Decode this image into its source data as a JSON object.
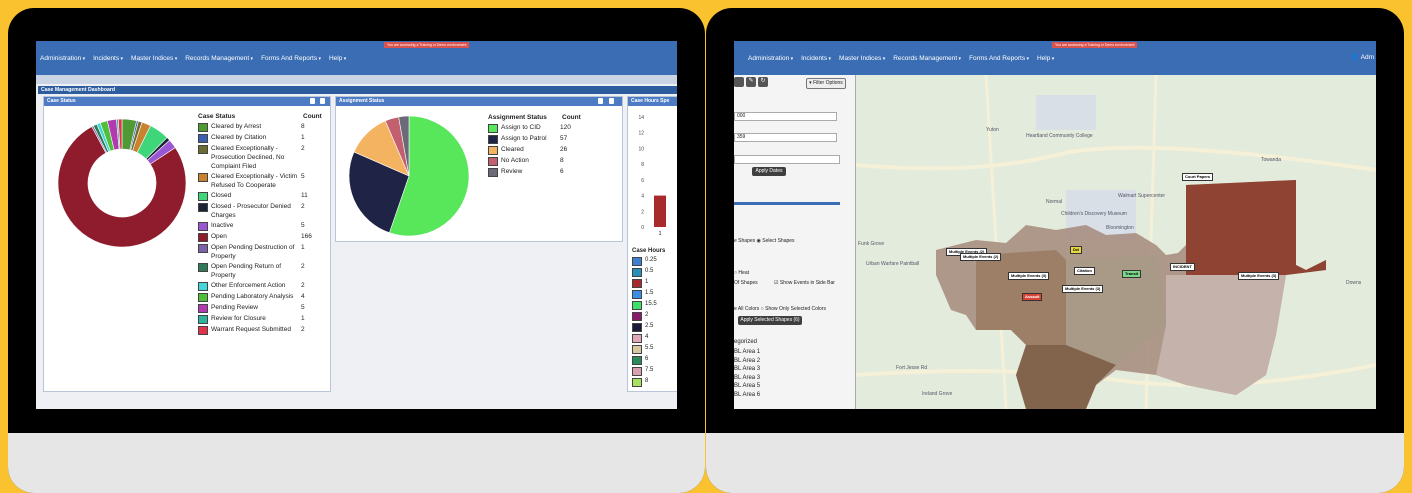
{
  "left_screen": {
    "nav": {
      "items": [
        "Administration",
        "Incidents",
        "Master Indices",
        "Records Management",
        "Forms And Reports",
        "Help"
      ],
      "notice": "You are accessing a Training or Demo environment"
    },
    "dashboard_title": "Case Management Dashboard",
    "case_status": {
      "title": "Case Status",
      "col_status": "Case Status",
      "col_count": "Count",
      "rows": [
        {
          "label": "Cleared by Arrest",
          "count": "8",
          "color": "#4f9a34"
        },
        {
          "label": "Cleared by Citation",
          "count": "1",
          "color": "#3b5fae"
        },
        {
          "label": "Cleared Exceptionally - Prosecution Declined, No Complaint Filed",
          "count": "2",
          "color": "#6b6b34"
        },
        {
          "label": "Cleared Exceptionally - Victim Refused To Cooperate",
          "count": "5",
          "color": "#c9822e"
        },
        {
          "label": "Closed",
          "count": "11",
          "color": "#3fd67a"
        },
        {
          "label": "Closed - Prosecutor Denied Charges",
          "count": "2",
          "color": "#1d2436"
        },
        {
          "label": "Inactive",
          "count": "5",
          "color": "#9b57d3"
        },
        {
          "label": "Open",
          "count": "166",
          "color": "#8f1c2c"
        },
        {
          "label": "Open Pending Destruction of Property",
          "count": "1",
          "color": "#7e62a8"
        },
        {
          "label": "Open Pending Return of Property",
          "count": "2",
          "color": "#2f7a58"
        },
        {
          "label": "Other Enforcement Action",
          "count": "2",
          "color": "#45d6d9"
        },
        {
          "label": "Pending Laboratory Analysis",
          "count": "4",
          "color": "#4fbf3a"
        },
        {
          "label": "Pending Review",
          "count": "5",
          "color": "#b13ab0"
        },
        {
          "label": "Review for Closure",
          "count": "1",
          "color": "#2ab59c"
        },
        {
          "label": "Warrant Request Submitted",
          "count": "2",
          "color": "#e0344a"
        }
      ]
    },
    "assignment_status": {
      "title": "Assignment Status",
      "col_status": "Assignment Status",
      "col_count": "Count",
      "rows": [
        {
          "label": "Assign to CID",
          "count": "120",
          "color": "#58e65a"
        },
        {
          "label": "Assign to Patrol",
          "count": "57",
          "color": "#1f2346"
        },
        {
          "label": "Cleared",
          "count": "26",
          "color": "#f3b360"
        },
        {
          "label": "No Action",
          "count": "8",
          "color": "#c36070"
        },
        {
          "label": "Review",
          "count": "6",
          "color": "#6a6a78"
        }
      ]
    },
    "case_hours": {
      "title": "Case Hours Spe",
      "y_ticks": [
        "14",
        "12",
        "10",
        "8",
        "6",
        "4",
        "2",
        "0"
      ],
      "x_tick": "1",
      "legend_title": "Case Hours",
      "legend": [
        {
          "label": "0.25",
          "color": "#3f7fd0"
        },
        {
          "label": "0.5",
          "color": "#2a8fb8"
        },
        {
          "label": "1",
          "color": "#a82a2a"
        },
        {
          "label": "1.5",
          "color": "#3b8ee6"
        },
        {
          "label": "15.5",
          "color": "#3de06a"
        },
        {
          "label": "2",
          "color": "#8a1a6a"
        },
        {
          "label": "2.5",
          "color": "#1a1a3a"
        },
        {
          "label": "4",
          "color": "#e0a8b8"
        },
        {
          "label": "5.5",
          "color": "#d8c8a0"
        },
        {
          "label": "6",
          "color": "#2a8a5a"
        },
        {
          "label": "7.5",
          "color": "#d8a0b0"
        },
        {
          "label": "8",
          "color": "#a8e060"
        }
      ]
    },
    "chart_data": [
      {
        "type": "pie",
        "title": "Case Status",
        "categories": [
          "Cleared by Arrest",
          "Cleared by Citation",
          "Cleared Exceptionally - Prosecution Declined, No Complaint Filed",
          "Cleared Exceptionally - Victim Refused To Cooperate",
          "Closed",
          "Closed - Prosecutor Denied Charges",
          "Inactive",
          "Open",
          "Open Pending Destruction of Property",
          "Open Pending Return of Property",
          "Other Enforcement Action",
          "Pending Laboratory Analysis",
          "Pending Review",
          "Review for Closure",
          "Warrant Request Submitted"
        ],
        "values": [
          8,
          1,
          2,
          5,
          11,
          2,
          5,
          166,
          1,
          2,
          2,
          4,
          5,
          1,
          2
        ],
        "donut": true
      },
      {
        "type": "pie",
        "title": "Assignment Status",
        "categories": [
          "Assign to CID",
          "Assign to Patrol",
          "Cleared",
          "No Action",
          "Review"
        ],
        "values": [
          120,
          57,
          26,
          8,
          6
        ]
      },
      {
        "type": "bar",
        "title": "Case Hours Spe",
        "categories": [
          "1"
        ],
        "ylim": [
          0,
          14
        ],
        "values": [
          4
        ]
      }
    ]
  },
  "right_screen": {
    "nav": {
      "items": [
        "Administration",
        "Incidents",
        "Master Indices",
        "Records Management",
        "Forms And Reports",
        "Help"
      ],
      "notice": "You are accessing a Training or Demo environment",
      "user": "Adm"
    },
    "filter_button": "Filter Options",
    "fields": [
      "000",
      "359"
    ],
    "apply_dates": "Apply Dates",
    "mode_text": "e Shapes",
    "select_shapes": "Select Shapes",
    "heat": "Heat",
    "of_shapes": "Of Shapes",
    "show_events": "Show Events in Side Bar",
    "all_colors": "e All Colors",
    "show_selected": "Show Only Selected Colors",
    "apply_selected": "Apply Selected Shapes (6)",
    "categorized": "egorized",
    "areas": [
      "BL Area 1",
      "BL Area 2",
      "BL Area 3",
      "BL Area 3",
      "BL Area 5",
      "BL Area 6"
    ],
    "map_labels": [
      "Multiple Events (2)",
      "Multiple Events (2)",
      "Multiple Events (3)",
      "Multiple Events (3)",
      "Multiple Events (3)",
      "Citation",
      "Transit",
      "INCIDENT",
      "Court Papers",
      "Assault",
      "Del"
    ],
    "places": [
      "Yuton",
      "Normal",
      "Heartland Community College",
      "Children's Discovery Museum",
      "Walmart Supercenter",
      "Towanda",
      "Urban Warfare Paintball",
      "Funk Grove",
      "Downs",
      "Fort Jesse Rd",
      "Bloomington",
      "Ireland Grove"
    ]
  }
}
